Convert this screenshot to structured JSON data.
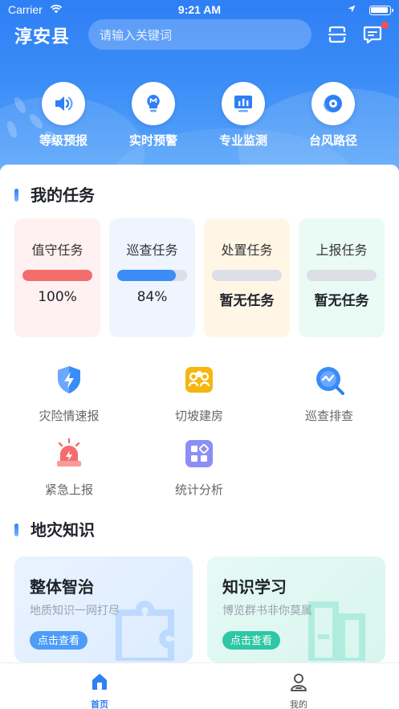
{
  "status_bar": {
    "carrier": "Carrier",
    "time": "9:21 AM"
  },
  "header": {
    "county": "淳安县",
    "search_placeholder": "请输入关键词",
    "quick_links": [
      {
        "label": "等级预报",
        "icon": "speaker-icon"
      },
      {
        "label": "实时预警",
        "icon": "alert-bulb-icon"
      },
      {
        "label": "专业监测",
        "icon": "monitor-chart-icon"
      },
      {
        "label": "台风路径",
        "icon": "typhoon-icon"
      }
    ]
  },
  "my_tasks": {
    "title": "我的任务",
    "cards": [
      {
        "name": "值守任务",
        "value": "100%",
        "progress": 1.0,
        "bg": "#fff1f1",
        "color": "#f56c6c"
      },
      {
        "name": "巡查任务",
        "value": "84%",
        "progress": 0.84,
        "bg": "#eef5ff",
        "color": "#3a8cf7"
      },
      {
        "name": "处置任务",
        "value": "暂无任务",
        "progress": 0,
        "bg": "#fff6e6",
        "color": "#f5a623"
      },
      {
        "name": "上报任务",
        "value": "暂无任务",
        "progress": 0,
        "bg": "#eafaf4",
        "color": "#2ec7a4"
      }
    ]
  },
  "functions": [
    {
      "label": "灾险情速报",
      "icon": "lightning-shield-icon"
    },
    {
      "label": "切坡建房",
      "icon": "people-group-icon"
    },
    {
      "label": "巡查排查",
      "icon": "search-inspect-icon"
    },
    {
      "label": "紧急上报",
      "icon": "siren-icon"
    },
    {
      "label": "统计分析",
      "icon": "grid-stats-icon"
    }
  ],
  "knowledge": {
    "title": "地灾知识",
    "cards": [
      {
        "title": "整体智治",
        "subtitle": "地质知识一网打尽",
        "button": "点击查看",
        "color": "#3a8cf7"
      },
      {
        "title": "知识学习",
        "subtitle": "博览群书非你莫属",
        "button": "点击查看",
        "color": "#2ec7a4"
      }
    ]
  },
  "tabbar": {
    "tabs": [
      {
        "label": "首页",
        "active": true
      },
      {
        "label": "我的",
        "active": false
      }
    ],
    "active_color": "#2f7ff5",
    "inactive_color": "#555555"
  }
}
